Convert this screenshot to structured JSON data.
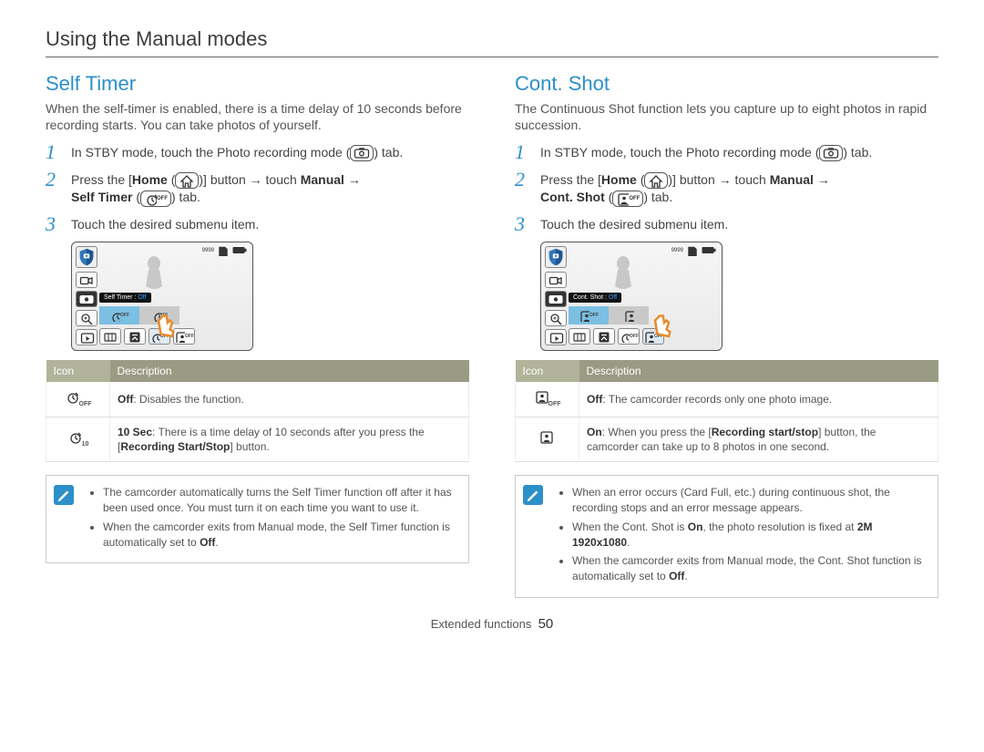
{
  "page_title": "Using the Manual modes",
  "footer_label": "Extended functions",
  "page_number": "50",
  "left": {
    "section_title": "Self Timer",
    "intro": "When the self-timer is enabled, there is a time delay of 10 seconds before recording starts. You can take photos of yourself.",
    "step1": "In STBY mode, touch the Photo recording mode (",
    "step1_tail": ") tab.",
    "step2_a": "Press the [",
    "step2_home": "Home",
    "step2_b": " (",
    "step2_c": ")] button ",
    "step2_arrow": "→",
    "step2_d": " touch ",
    "step2_manual": "Manual",
    "step2_e": " ",
    "step2_tabname": "Self Timer",
    "step2_tail": " (",
    "step2_tail2": ") tab.",
    "step3": "Touch the desired submenu item.",
    "shot_counter": "9999",
    "shot_label": "Self Timer : ",
    "shot_label_val": "Off",
    "opt_off": "OFF",
    "opt_on": "10",
    "table": {
      "h_icon": "Icon",
      "h_desc": "Description",
      "r1_bold": "Off",
      "r1_rest": ": Disables the function.",
      "r2_bold": "10 Sec",
      "r2_rest": ": There is a time delay of 10 seconds after you press the [",
      "r2_btn": "Recording Start/Stop",
      "r2_tail": "] button."
    },
    "note": {
      "b1": "The camcorder automatically turns the Self Timer function off after it has been used once. You must turn it on each time you want to use it.",
      "b2_a": "When the camcorder exits from Manual mode, the Self Timer function is automatically set to ",
      "b2_bold": "Off",
      "b2_tail": "."
    }
  },
  "right": {
    "section_title": "Cont. Shot",
    "intro": "The Continuous Shot function lets you capture up to eight photos in rapid succession.",
    "step1": "In STBY mode, touch the Photo recording mode (",
    "step1_tail": ") tab.",
    "step2_a": "Press the [",
    "step2_home": "Home",
    "step2_b": " (",
    "step2_c": ")] button ",
    "step2_arrow": "→",
    "step2_d": " touch ",
    "step2_manual": "Manual",
    "step2_e": " ",
    "step2_tabname": "Cont. Shot",
    "step2_tail": " (",
    "step2_tail2": ") tab.",
    "step3": "Touch the desired submenu item.",
    "shot_counter": "9999",
    "shot_label": "Cont. Shot : ",
    "shot_label_val": "Off",
    "opt_off_sub": "OFF",
    "table": {
      "h_icon": "Icon",
      "h_desc": "Description",
      "r1_bold": "Off",
      "r1_rest": ": The camcorder records only one photo image.",
      "r2_bold": "On",
      "r2_rest": ": When you press the [",
      "r2_btn": "Recording start/stop",
      "r2_mid": "] button, the camcorder can take up to 8 photos in one second."
    },
    "note": {
      "b1": "When an error occurs (Card Full, etc.) during continuous shot, the recording stops and an error message appears.",
      "b2_a": "When the Cont. Shot is ",
      "b2_bold_on": "On",
      "b2_b": ", the photo resolution is fixed at ",
      "b2_bold_res": "2M 1920x1080",
      "b2_tail": ".",
      "b3_a": "When the camcorder exits from Manual mode, the Cont. Shot function is automatically set to ",
      "b3_bold": "Off",
      "b3_tail": "."
    }
  }
}
